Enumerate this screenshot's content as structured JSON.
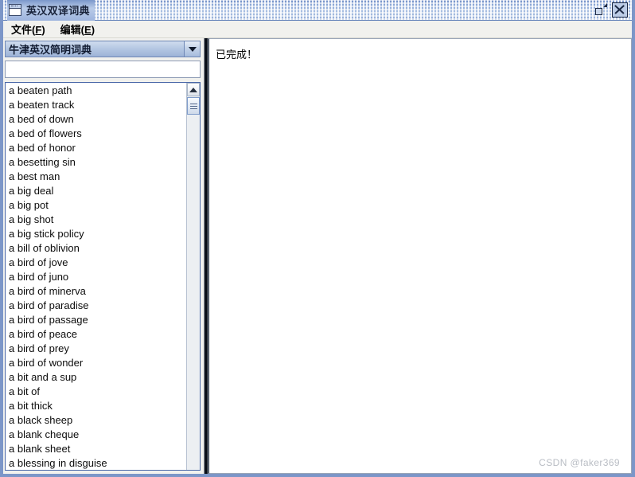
{
  "window": {
    "title": "英汉双译词典",
    "icon": "window-icon",
    "controls": {
      "restore_label": "",
      "close_label": ""
    }
  },
  "menubar": {
    "items": [
      {
        "label": "文件",
        "mnemonic": "F"
      },
      {
        "label": "编辑",
        "mnemonic": "E"
      }
    ]
  },
  "sidebar": {
    "dictionary_select": {
      "selected": "牛津英汉简明词典",
      "icon": "chevron-down-icon"
    },
    "search": {
      "value": "",
      "placeholder": ""
    },
    "scrollbar": {
      "up_icon": "triangle-up-icon",
      "thumb": "scrollbar-thumb"
    },
    "word_list": [
      "a beaten path",
      "a beaten track",
      "a bed of down",
      "a bed of flowers",
      "a bed of honor",
      "a besetting sin",
      "a best man",
      "a big deal",
      "a big pot",
      "a big shot",
      "a big stick policy",
      "a bill of oblivion",
      "a bird of jove",
      "a bird of juno",
      "a bird of minerva",
      "a bird of paradise",
      "a bird of passage",
      "a bird of peace",
      "a bird of prey",
      "a bird of wonder",
      "a bit and a sup",
      "a bit of",
      "a bit thick",
      "a black sheep",
      "a blank cheque",
      "a blank sheet",
      "a blessing in disguise"
    ]
  },
  "content": {
    "status_text": "已完成！",
    "watermark": "CSDN @faker369"
  },
  "colors": {
    "titlebar_blue": "#8fa8d6",
    "window_border": "#7c96c8",
    "combo_blue": "#b3c6e2",
    "list_border": "#4a68a8",
    "watermark_gray": "#b9bdc4"
  }
}
